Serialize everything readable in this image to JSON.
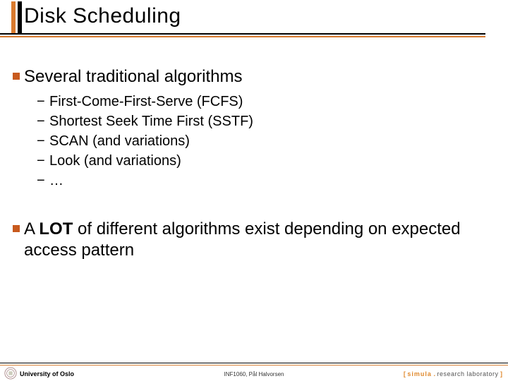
{
  "title": "Disk Scheduling",
  "body": {
    "point1": {
      "text": "Several traditional algorithms",
      "sub": [
        "First-Come-First-Serve (FCFS)",
        "Shortest Seek Time First (SSTF)",
        "SCAN (and variations)",
        "Look (and variations)",
        "…"
      ]
    },
    "point2": {
      "pre": "A ",
      "bold": "LOT",
      "post": " of different algorithms exist depending on expected access pattern"
    }
  },
  "footer": {
    "left": "University of Oslo",
    "center": "INF1060, Pål Halvorsen",
    "right": {
      "open": "[ ",
      "brand": "simula",
      "dot": " . ",
      "grey": "research laboratory",
      "close": " ]"
    }
  }
}
